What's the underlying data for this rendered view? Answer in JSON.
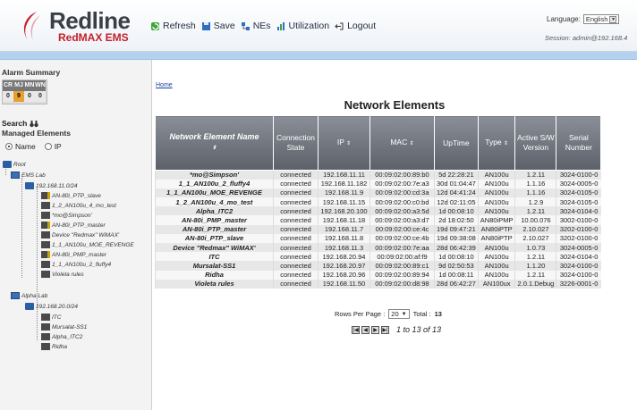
{
  "header": {
    "logo_text": "Redline",
    "logo_sub": "RedMAX EMS",
    "toolbar": [
      {
        "label": "Refresh",
        "icon": "refresh-icon"
      },
      {
        "label": "Save",
        "icon": "save-icon"
      },
      {
        "label": "NEs",
        "icon": "nes-icon"
      },
      {
        "label": "Utilization",
        "icon": "utilization-icon"
      },
      {
        "label": "Logout",
        "icon": "logout-icon"
      }
    ],
    "language_label": "Language:",
    "language_value": "English",
    "session": "Session: admin@192.168.4"
  },
  "sidebar": {
    "alarm_summary_title": "Alarm Summary",
    "alarm_headers": [
      "CR",
      "MJ",
      "MN",
      "WN"
    ],
    "alarm_values": [
      "0",
      "9",
      "0",
      "0"
    ],
    "search_label": "Search",
    "managed_title": "Managed Elements",
    "radio_name": "Name",
    "radio_ip": "IP",
    "tree": {
      "root": "Root",
      "ems_lab": "EMS Lab",
      "subnet1": "192.168.11.0/24",
      "ems_items": [
        "AN-80i_PTP_slave",
        "1_2_AN100u_4_mo_test",
        "*mo@Simpson'",
        "AN-80i_PTP_master",
        "Device \"Redmax\" WiMAX'",
        "1_1_AN100u_MOE_REVENGE",
        "AN-80i_PMP_master",
        "1_1_AN100u_2_fluffy4",
        "Violeta rules"
      ],
      "alpha_lab": "Alpha Lab",
      "subnet2": "192.168.20.0/24",
      "alpha_items": [
        "ITC",
        "Mursalat-SS1",
        "Alpha_ITC2",
        "Ridha"
      ]
    }
  },
  "main": {
    "home_link": "Home",
    "title": "Network Elements",
    "columns": {
      "name": "Network Element Name",
      "state_1": "Connection",
      "state_2": "State",
      "ip": "IP",
      "mac": "MAC",
      "uptime": "UpTime",
      "type": "Type",
      "sw_1": "Active S/W",
      "sw_2": "Version",
      "serial_1": "Serial",
      "serial_2": "Number"
    },
    "rows": [
      [
        "*mo@Simpson'",
        "connected",
        "192.168.11.11",
        "00:09:02:00:89:b0",
        "5d 22:28:21",
        "AN100u",
        "1.2.11",
        "3024-0100-0"
      ],
      [
        "1_1_AN100u_2_fluffy4",
        "connected",
        "192.168.11.182",
        "00:09:02:00:7e:a3",
        "30d 01:04:47",
        "AN100u",
        "1.1.16",
        "3024-0005-0"
      ],
      [
        "1_1_AN100u_MOE_REVENGE",
        "connected",
        "192.168.11.9",
        "00:09:02:00:cd:3a",
        "12d 04:41:24",
        "AN100u",
        "1.1.16",
        "3024-0105-0"
      ],
      [
        "1_2_AN100u_4_mo_test",
        "connected",
        "192.168.11.15",
        "00:09:02:00:c0:bd",
        "12d 02:11:05",
        "AN100u",
        "1.2.9",
        "3024-0105-0"
      ],
      [
        "Alpha_ITC2",
        "connected",
        "192.168.20.100",
        "00:09:02:00:a3:5d",
        "1d 00:08:10",
        "AN100u",
        "1.2.11",
        "3024-0104-0"
      ],
      [
        "AN-80i_PMP_master",
        "connected",
        "192.168.11.18",
        "00:09:02:00:a3:d7",
        "2d 18:02:50",
        "AN80iPMP",
        "10.00.076",
        "3002-0100-0"
      ],
      [
        "AN-80i_PTP_master",
        "connected",
        "192.168.11.7",
        "00:09:02:00:ce:4c",
        "19d 09:47:21",
        "AN80iPTP",
        "2.10.027",
        "3202-0100-0"
      ],
      [
        "AN-80i_PTP_slave",
        "connected",
        "192.168.11.8",
        "00:09:02:00:ce:4b",
        "19d 09:38:08",
        "AN80iPTP",
        "2.10.027",
        "3202-0100-0"
      ],
      [
        "Device \"Redmax\" WiMAX'",
        "connected",
        "192.168.11.3",
        "00:09:02:00:7e:aa",
        "28d 06:42:39",
        "AN100u",
        "1.0.73",
        "3024-0005-0"
      ],
      [
        "ITC",
        "connected",
        "192.168.20.94",
        "00:09:02:00:af:f9",
        "1d 00:08:10",
        "AN100u",
        "1.2.11",
        "3024-0104-0"
      ],
      [
        "Mursalat-SS1",
        "connected",
        "192.168.20.97",
        "00:09:02:00:89:c1",
        "9d 02:50:53",
        "AN100u",
        "1.1.20",
        "3024-0100-0"
      ],
      [
        "Ridha",
        "connected",
        "192.168.20.96",
        "00:09:02:00:89:94",
        "1d 00:08:11",
        "AN100u",
        "1.2.11",
        "3024-0100-0"
      ],
      [
        "Violeta rules",
        "connected",
        "192.168.11.50",
        "00:09:02:00:d8:98",
        "28d 06:42:27",
        "AN100ux",
        "2.0.1.Debug",
        "3226-0001-0"
      ]
    ],
    "rows_per_page_label": "Rows Per Page :",
    "rows_per_page_value": "20",
    "total_label": "Total :",
    "total_value": "13",
    "pager_text": "1 to 13 of 13"
  },
  "colors": {
    "brand_red": "#c3202c",
    "header_band": "#b4d2ee",
    "table_header": "#6d727a",
    "alarm_major": "#e8a030"
  }
}
